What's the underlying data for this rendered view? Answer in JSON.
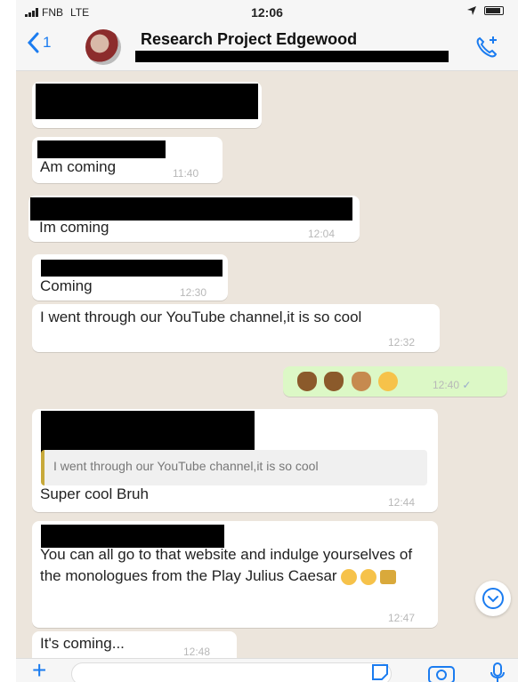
{
  "status_bar": {
    "carrier": "FNB",
    "network": "LTE",
    "time": "12:06"
  },
  "header": {
    "back_count": "1",
    "title": "Research Project Edgewood",
    "icons": {
      "back": "chevron-left-icon",
      "call": "add-call-icon"
    }
  },
  "messages": [
    {
      "text": "",
      "time": ""
    },
    {
      "text": "Am coming",
      "time": "11:40"
    },
    {
      "text": "Im coming",
      "time": "12:04"
    },
    {
      "text": "Coming",
      "time": "12:30"
    },
    {
      "text": "I went through our YouTube channel,it is so cool",
      "time": "12:32"
    },
    {
      "text": "",
      "time": "12:40",
      "emojis": [
        "rock-on-dark",
        "rock-on-dark",
        "victory-hand",
        "kissing-face"
      ],
      "outgoing": true
    },
    {
      "quote": "I went through our YouTube channel,it is so cool",
      "text": "Super cool Bruh",
      "time": "12:44"
    },
    {
      "text": "You can all go to that website and indulge yourselves of the monologues from the Play Julius Caesar",
      "time": "12:47",
      "emojis": [
        "grin-face",
        "smile-face",
        "crown"
      ]
    },
    {
      "text": "It's coming...",
      "time": "12:48"
    }
  ],
  "colors": {
    "accent": "#1b7cf0",
    "chat_background": "#ece5dc",
    "outgoing_bubble": "#dcf8c6",
    "incoming_bubble": "#ffffff",
    "quote_bar": "#c7a93a"
  },
  "input_bar": {
    "icons": [
      "plus-icon",
      "sticker-icon",
      "camera-icon",
      "microphone-icon"
    ]
  }
}
